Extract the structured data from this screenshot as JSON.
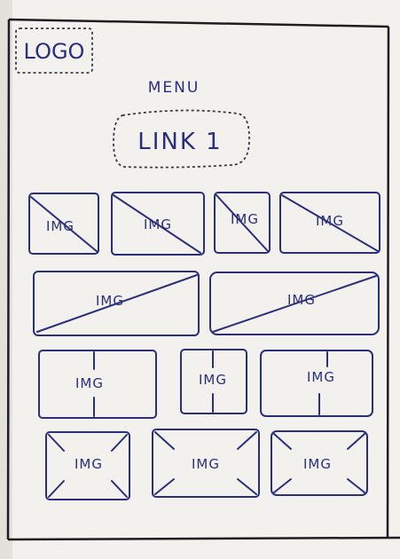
{
  "header": {
    "logo": "LOGO",
    "menu_title": "MENU",
    "link": "LINK 1"
  },
  "gallery": {
    "placeholder_label": "IMG",
    "rows": [
      {
        "items": [
          {
            "style": "diagonal"
          },
          {
            "style": "diagonal"
          },
          {
            "style": "diagonal"
          },
          {
            "style": "diagonal"
          }
        ]
      },
      {
        "items": [
          {
            "style": "diagonal"
          },
          {
            "style": "diagonal"
          }
        ]
      },
      {
        "items": [
          {
            "style": "vertical"
          },
          {
            "style": "vertical"
          },
          {
            "style": "vertical"
          }
        ]
      },
      {
        "items": [
          {
            "style": "x-corners"
          },
          {
            "style": "x-corners"
          },
          {
            "style": "x-corners"
          }
        ]
      }
    ]
  },
  "colors": {
    "paper": "#f2f1ee",
    "ink": "#2b2f7a",
    "frame": "#1d1d22"
  }
}
